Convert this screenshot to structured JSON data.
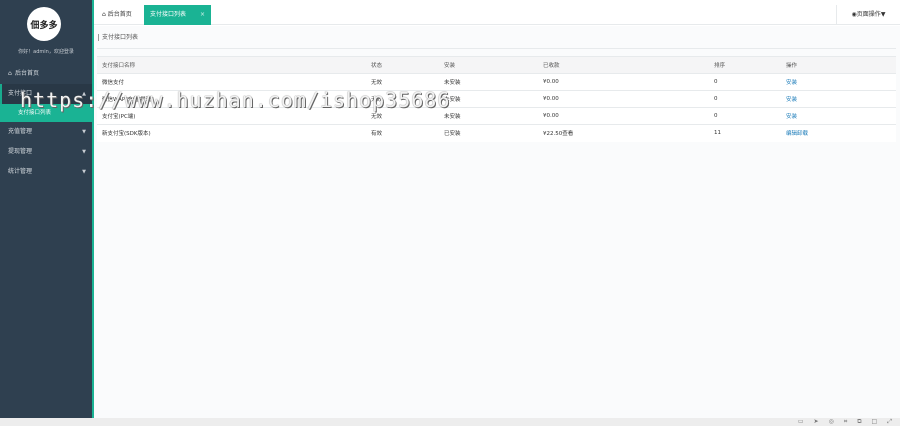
{
  "sidebar": {
    "logo_text": "佃多多",
    "welcome": "你好！admin，欢迎登录",
    "items": [
      {
        "label": "后台首页",
        "icon": "home-icon"
      },
      {
        "label": "支付接口",
        "icon": ""
      },
      {
        "label": "支付接口列表"
      },
      {
        "label": "充值管理"
      },
      {
        "label": "提现管理"
      },
      {
        "label": "统计管理"
      }
    ]
  },
  "tabs": {
    "home": "后台首页",
    "active": "支付接口列表",
    "close": "×"
  },
  "page_op": "页面操作",
  "panel": {
    "title": "支付接口列表",
    "columns": [
      "支付接口名称",
      "状态",
      "安装",
      "已收款",
      "排序",
      "操作"
    ],
    "rows": [
      [
        "微信支付",
        "无效",
        "未安装",
        "¥0.00",
        "0",
        "安装"
      ],
      [
        "微信WAP(充值/提现)",
        "无效",
        "未安装",
        "¥0.00",
        "0",
        "安装"
      ],
      [
        "支付宝(PC端)",
        "无效",
        "未安装",
        "¥0.00",
        "0",
        "安装"
      ],
      [
        "新支付宝(SDK版本)",
        "有效",
        "已安装",
        "¥22.50查看",
        "11",
        "编辑卸载"
      ]
    ]
  },
  "watermark": "https://www.huzhan.com/ishop35686",
  "colors": {
    "sidebar": "#2f4050",
    "accent": "#1ab394",
    "link": "#1a7bb9"
  }
}
